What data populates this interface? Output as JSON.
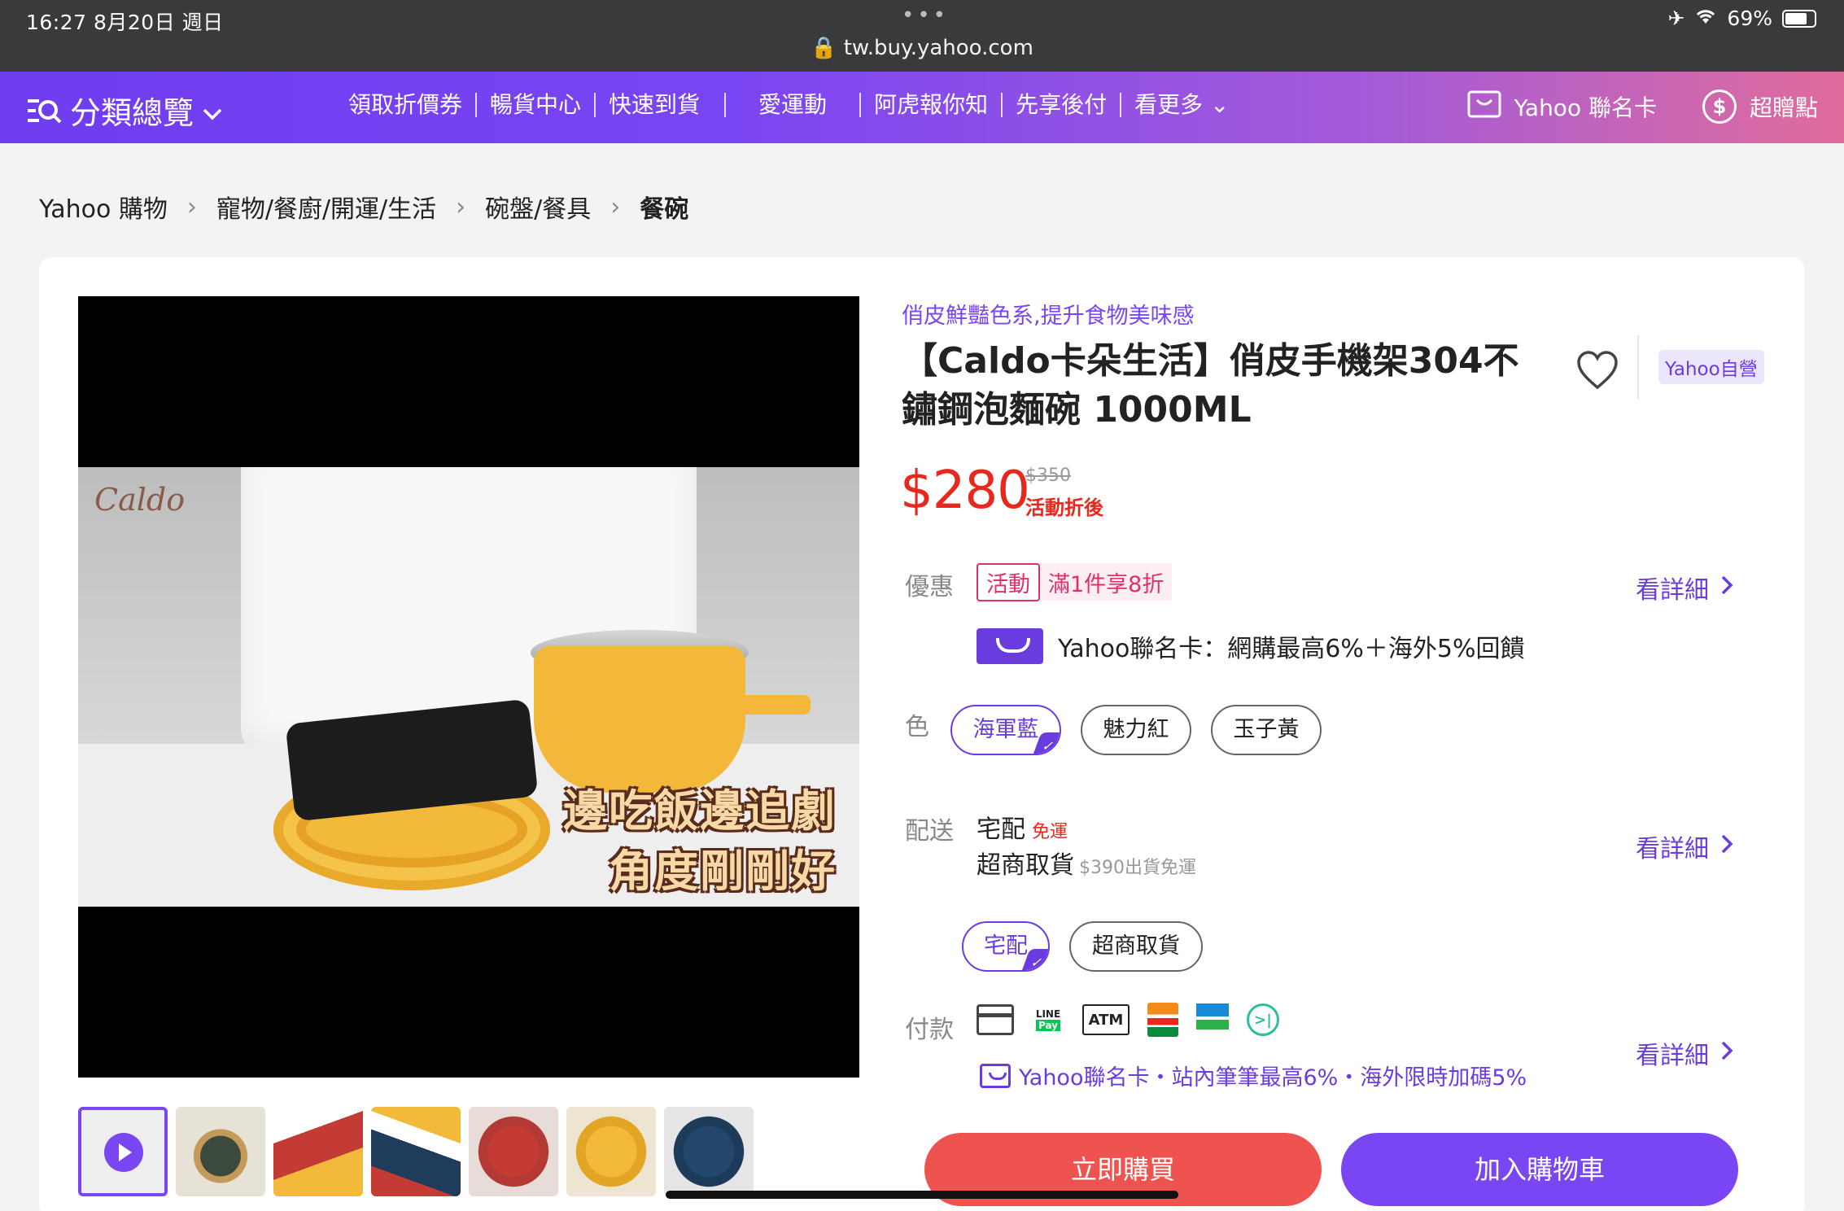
{
  "status": {
    "time": "16:27   8月20日 週日",
    "dots": "•••",
    "url": "tw.buy.yahoo.com",
    "battery": "69%",
    "icons": [
      "airplane-icon",
      "wifi-icon",
      "battery-icon"
    ]
  },
  "nav": {
    "category": "分類總覽",
    "links": [
      "領取折價券",
      "暢貨中心",
      "快速到貨",
      "愛運動",
      "阿虎報你知",
      "先享後付",
      "看更多"
    ],
    "card": "Yahoo 聯名卡",
    "points": "超贈點"
  },
  "breadcrumb": [
    "Yahoo 購物",
    "寵物/餐廚/開運/生活",
    "碗盤/餐具",
    "餐碗"
  ],
  "video": {
    "brand": "Caldo",
    "caption1": "邊吃飯邊追劇",
    "caption2": "角度剛剛好"
  },
  "product": {
    "subtitle": "俏皮鮮豔色系,提升食物美味感",
    "title": "【Caldo卡朵生活】俏皮手機架304不鏽鋼泡麵碗 1000ML",
    "badge": "Yahoo自營",
    "price": "$280",
    "original_price": "$350",
    "price_note": "活動折後"
  },
  "promo": {
    "label": "優惠",
    "tag": "活動",
    "text": "滿1件享8折",
    "card_text": "Yahoo聯名卡：網購最高6%＋海外5%回饋",
    "detail": "看詳細"
  },
  "color": {
    "label": "色",
    "options": [
      "海軍藍",
      "魅力紅",
      "玉子黃"
    ],
    "selected": "海軍藍"
  },
  "shipping": {
    "label": "配送",
    "home": "宅配",
    "free": "免運",
    "store": "超商取貨",
    "store_note": "$390出貨免運",
    "detail": "看詳細",
    "options": [
      "宅配",
      "超商取貨"
    ],
    "selected": "宅配"
  },
  "payment": {
    "label": "付款",
    "line_top": "LINE",
    "line_pay": "Pay",
    "atm": "ATM",
    "next": ">|",
    "promo": "Yahoo聯名卡・站內筆筆最高6%・海外限時加碼5%",
    "detail": "看詳細"
  },
  "actions": {
    "buy": "立即購買",
    "cart": "加入購物車"
  },
  "colors": {
    "accent": "#7a45f2",
    "price": "#e8271d",
    "buy": "#ef5350"
  }
}
